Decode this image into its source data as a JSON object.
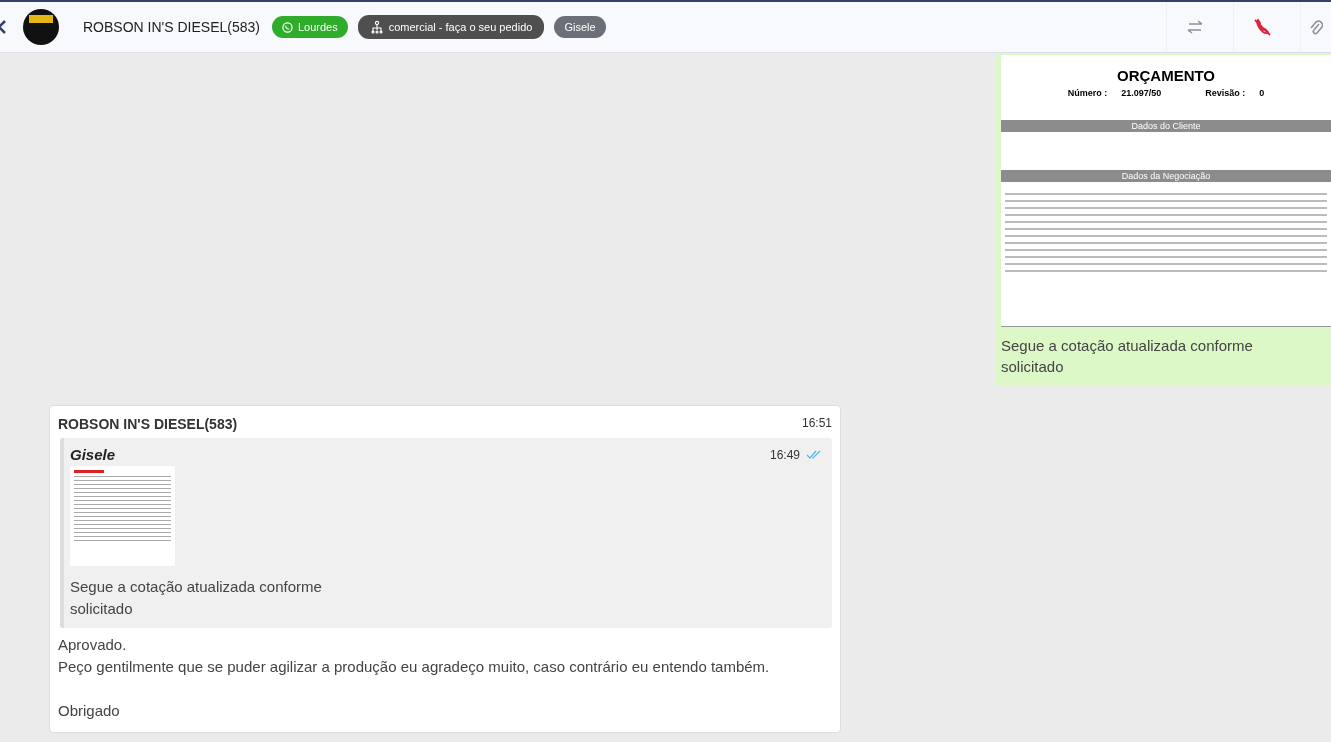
{
  "header": {
    "contact": "ROBSON IN'S DIESEL(583)",
    "tags": [
      {
        "kind": "whatsapp",
        "label": "Lourdes"
      },
      {
        "kind": "queue",
        "label": "comercial - faça o seu pedido"
      },
      {
        "kind": "user",
        "label": "Gisele"
      }
    ]
  },
  "messages": [
    {
      "kind": "outgoing",
      "document": {
        "title": "ORÇAMENTO",
        "number_label": "Número :",
        "number": "21.097/50",
        "revision_label": "Revisão :",
        "revision": "0",
        "sections": [
          "Dados do Cliente",
          "Dados da Negociação"
        ]
      },
      "caption": "Segue a cotação atualizada conforme solicitado"
    },
    {
      "kind": "incoming",
      "sender": "ROBSON IN'S DIESEL(583)",
      "time": "16:51",
      "quote": {
        "author": "Gisele",
        "time": "16:49",
        "read": true,
        "caption": "Segue a cotação atualizada conforme solicitado"
      },
      "paragraphs": [
        [
          "Aprovado.",
          "Peço gentilmente que se puder agilizar a produção eu agradeço muito, caso contrário eu entendo também."
        ],
        [
          "Obrigado"
        ]
      ]
    }
  ]
}
